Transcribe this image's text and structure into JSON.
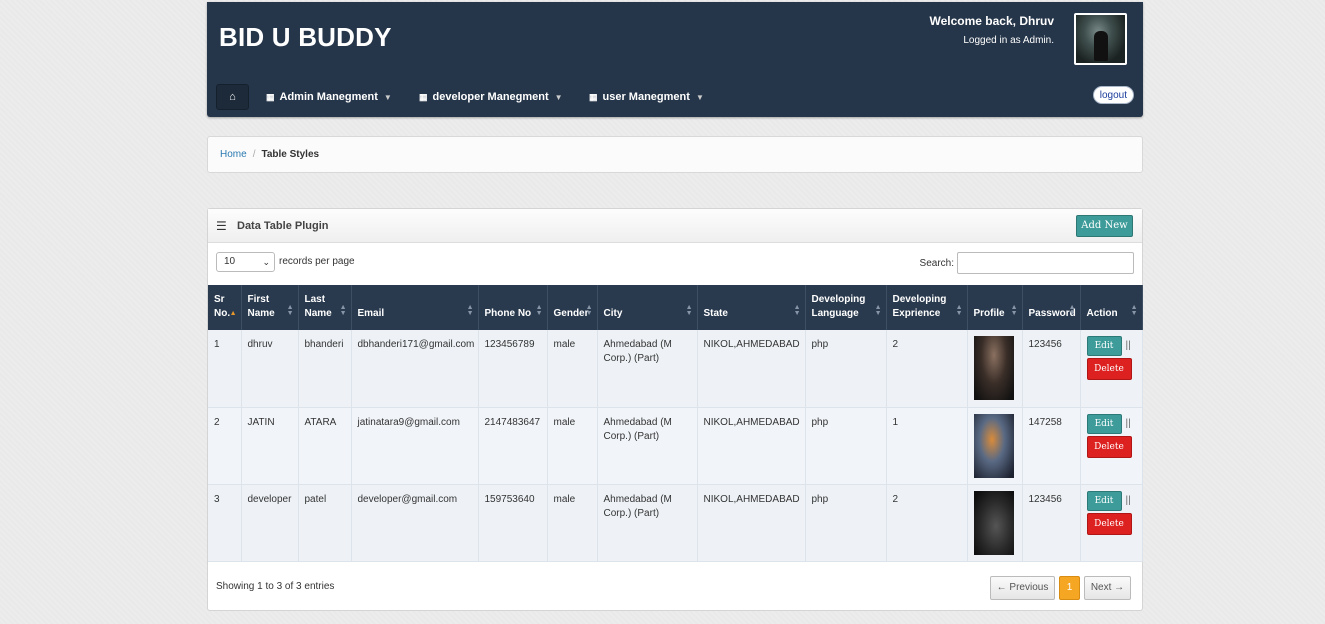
{
  "header": {
    "brand": "BID U BUDDY",
    "welcome": "Welcome back, Dhruv",
    "logged_in": "Logged in as Admin.",
    "logout": "logout",
    "nav": [
      {
        "label": "Admin Manegment"
      },
      {
        "label": "developer Manegment"
      },
      {
        "label": "user Manegment"
      }
    ]
  },
  "breadcrumb": {
    "home": "Home",
    "sep": "/",
    "current": "Table Styles"
  },
  "panel": {
    "title": "Data Table Plugin",
    "add_new": "Add New",
    "length_value": "10",
    "length_label": "records per page",
    "search_label": "Search:",
    "search_value": ""
  },
  "table": {
    "headers": [
      "Sr No.",
      "First Name",
      "Last Name",
      "Email",
      "Phone No",
      "Gender",
      "City",
      "State",
      "Developing Language",
      "Developing Exprience",
      "Profile",
      "Password",
      "Action"
    ],
    "rows": [
      {
        "sr": "1",
        "first": "dhruv",
        "last": "bhanderi",
        "email": "dbhanderi171@gmail.com",
        "phone": "123456789",
        "gender": "male",
        "city": "Ahmedabad (M Corp.) (Part)",
        "state": "NIKOL,AHMEDABAD",
        "lang": "php",
        "exp": "2",
        "password": "123456"
      },
      {
        "sr": "2",
        "first": "JATIN",
        "last": "ATARA",
        "email": "jatinatara9@gmail.com",
        "phone": "2147483647",
        "gender": "male",
        "city": "Ahmedabad (M Corp.) (Part)",
        "state": "NIKOL,AHMEDABAD",
        "lang": "php",
        "exp": "1",
        "password": "147258"
      },
      {
        "sr": "3",
        "first": "developer",
        "last": "patel",
        "email": "developer@gmail.com",
        "phone": "159753640",
        "gender": "male",
        "city": "Ahmedabad (M Corp.) (Part)",
        "state": "NIKOL,AHMEDABAD",
        "lang": "php",
        "exp": "2",
        "password": "123456"
      }
    ],
    "edit_label": "Edit",
    "delete_label": "Delete",
    "pipe": "||"
  },
  "footer": {
    "info": "Showing 1 to 3 of 3 entries",
    "prev": "← Previous",
    "page": "1",
    "next": "Next →"
  }
}
